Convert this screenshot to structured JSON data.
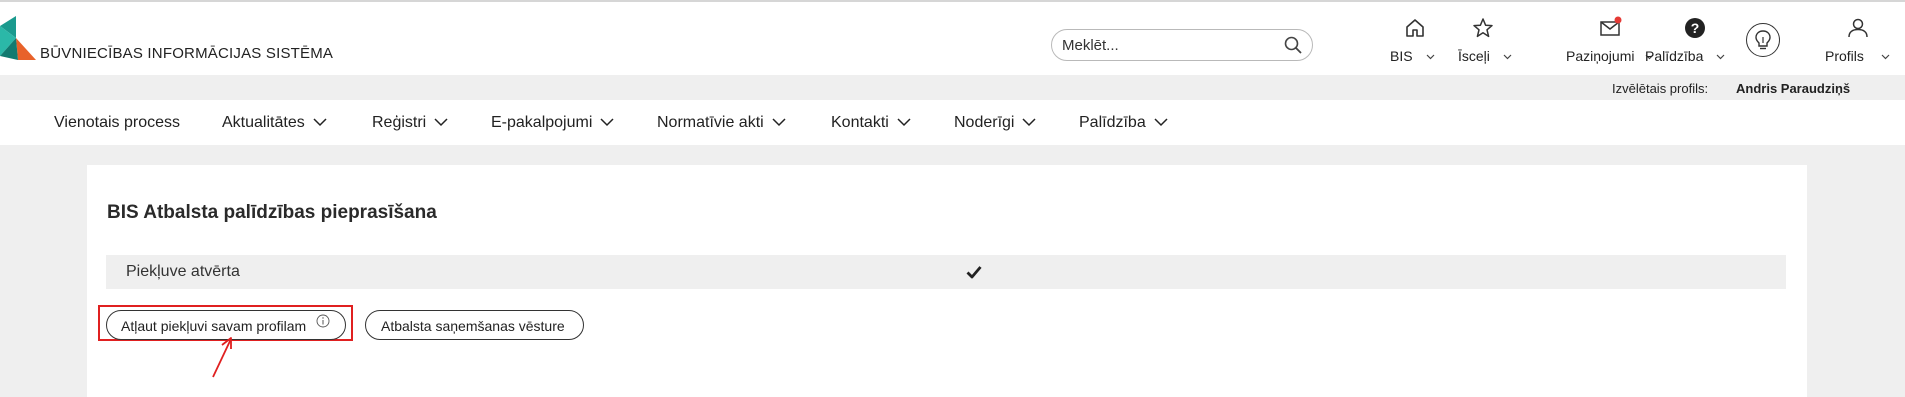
{
  "header": {
    "brand": "BŪVNIECĪBAS INFORMĀCIJAS SISTĒMA",
    "search_placeholder": "Meklēt...",
    "nav": [
      {
        "label": "BIS",
        "icon": "home-icon"
      },
      {
        "label": "Īsceļi",
        "icon": "star-icon"
      },
      {
        "label": "Paziņojumi",
        "icon": "envelope-icon",
        "badge_color": "#e53935"
      },
      {
        "label": "Palīdzība",
        "icon": "help-icon"
      },
      {
        "label": "Profils",
        "icon": "user-icon"
      }
    ],
    "extra_icon": "lightbulb-icon"
  },
  "profile_bar": {
    "label": "Izvēlētais profils:",
    "name": "Andris Paraudziņš"
  },
  "menu": [
    {
      "label": "Vienotais process",
      "has_dropdown": false
    },
    {
      "label": "Aktualitātes",
      "has_dropdown": true
    },
    {
      "label": "Reģistri",
      "has_dropdown": true
    },
    {
      "label": "E-pakalpojumi",
      "has_dropdown": true
    },
    {
      "label": "Normatīvie akti",
      "has_dropdown": true
    },
    {
      "label": "Kontakti",
      "has_dropdown": true
    },
    {
      "label": "Noderīgi",
      "has_dropdown": true
    },
    {
      "label": "Palīdzība",
      "has_dropdown": true
    }
  ],
  "main": {
    "title": "BIS Atbalsta palīdzības pieprasīšana",
    "row_label": "Piekļuve atvērta",
    "row_status_icon": "checkmark-icon",
    "allow_button": "Atļaut piekļuvi savam profilam",
    "history_button": "Atbalsta saņemšanas vēsture"
  },
  "colors": {
    "highlight": "#e02020",
    "logo_teal": "#1a9a8e",
    "logo_orange": "#e8622a",
    "badge": "#e53935"
  }
}
